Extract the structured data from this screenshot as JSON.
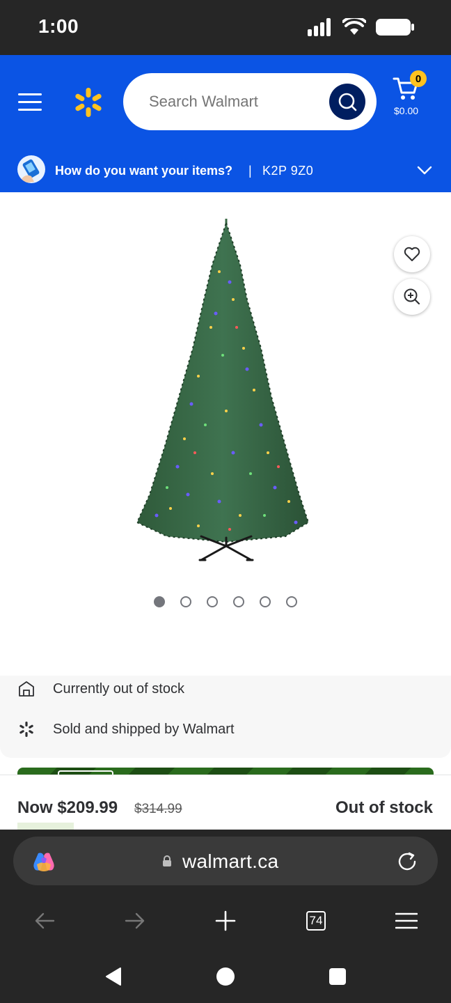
{
  "status_bar": {
    "time": "1:00"
  },
  "header": {
    "search": {
      "placeholder": "Search Walmart"
    },
    "cart": {
      "count": "0",
      "total": "$0.00"
    },
    "delivery": {
      "question": "How do you want your items?",
      "separator": "|",
      "postal_code": "K2P 9Z0"
    }
  },
  "product": {
    "carousel": {
      "total_images": 6,
      "active_index": 0
    },
    "info": [
      {
        "icon": "store-icon",
        "text": "Currently out of stock"
      },
      {
        "icon": "walmart-spark-icon",
        "text": "Sold and shipped by Walmart"
      }
    ],
    "price": {
      "now": "Now $209.99",
      "was": "$314.99",
      "stock_status": "Out of stock"
    }
  },
  "browser": {
    "url": "walmart.ca",
    "tab_count": "74"
  },
  "colors": {
    "walmart_blue": "#0B54E4",
    "walmart_yellow": "#FFC220",
    "search_button": "#001E60",
    "dark_chrome": "#262626"
  }
}
